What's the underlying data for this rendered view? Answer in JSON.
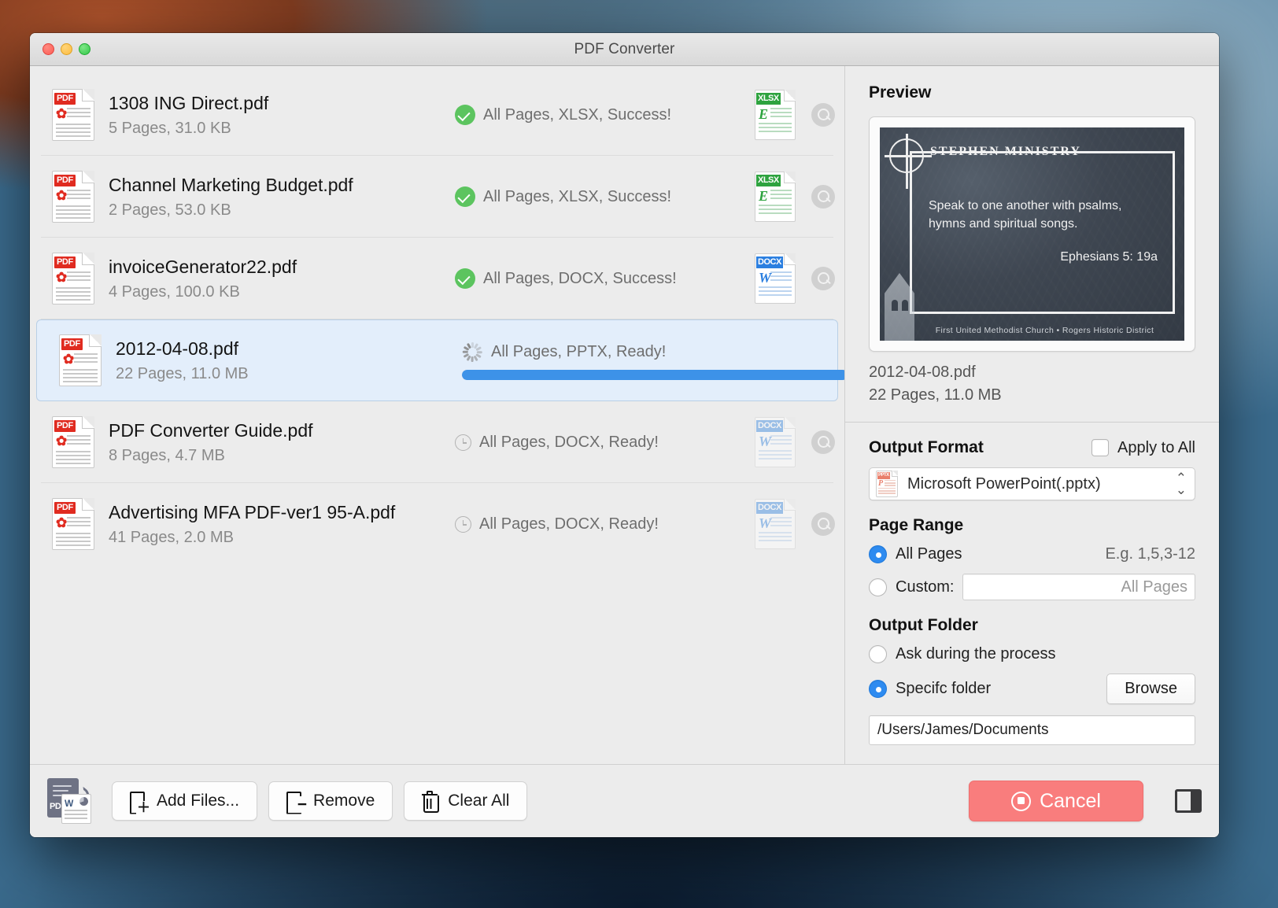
{
  "window": {
    "title": "PDF Converter",
    "traffic_lights": [
      "close-button",
      "minimize-button",
      "maximize-button"
    ]
  },
  "files": [
    {
      "name": "1308 ING Direct.pdf",
      "meta": "5 Pages, 31.0 KB",
      "status": "All Pages, XLSX, Success!",
      "state": "success",
      "format": "XLSX",
      "format_glyph": "E",
      "selected": false,
      "progress": null
    },
    {
      "name": "Channel Marketing Budget.pdf",
      "meta": "2 Pages, 53.0 KB",
      "status": "All Pages, XLSX, Success!",
      "state": "success",
      "format": "XLSX",
      "format_glyph": "E",
      "selected": false,
      "progress": null
    },
    {
      "name": "invoiceGenerator22.pdf",
      "meta": "4 Pages, 100.0 KB",
      "status": "All Pages, DOCX, Success!",
      "state": "success",
      "format": "DOCX",
      "format_glyph": "W",
      "selected": false,
      "progress": null
    },
    {
      "name": "2012-04-08.pdf",
      "meta": "22 Pages, 11.0 MB",
      "status": "All Pages, PPTX, Ready!",
      "state": "converting",
      "format": "PPTX",
      "format_glyph": "P",
      "selected": true,
      "progress": 89
    },
    {
      "name": "PDF Converter Guide.pdf",
      "meta": "8 Pages, 4.7 MB",
      "status": "All Pages, DOCX, Ready!",
      "state": "ready",
      "format": "DOCX",
      "format_glyph": "W",
      "selected": false,
      "progress": null
    },
    {
      "name": "Advertising MFA PDF-ver1 95-A.pdf",
      "meta": "41 Pages, 2.0 MB",
      "status": "All Pages, DOCX, Ready!",
      "state": "ready",
      "format": "DOCX",
      "format_glyph": "W",
      "selected": false,
      "progress": null
    }
  ],
  "preview": {
    "heading": "Preview",
    "slide": {
      "brand": "STEPHEN  MINISTRY",
      "quote": "Speak to one another with psalms, hymns and spiritual songs.",
      "reference": "Ephesians 5: 19a",
      "footer": "First United Methodist Church • Rogers Historic District"
    },
    "file_name": "2012-04-08.pdf",
    "file_meta": "22 Pages, 11.0 MB"
  },
  "output_format": {
    "heading": "Output Format",
    "apply_to_all_label": "Apply to All",
    "apply_to_all_checked": false,
    "selected": "Microsoft PowerPoint(.pptx)",
    "selected_format": "PPTX",
    "selected_glyph": "P",
    "chevron": "⌃⌄"
  },
  "page_range": {
    "heading": "Page Range",
    "all_pages_label": "All Pages",
    "all_pages_selected": true,
    "custom_label": "Custom:",
    "custom_selected": false,
    "example_hint": "E.g. 1,5,3-12",
    "custom_placeholder": "All Pages"
  },
  "output_folder": {
    "heading": "Output Folder",
    "ask_label": "Ask during the process",
    "ask_selected": false,
    "specific_label": "Specifc folder",
    "specific_selected": true,
    "browse_label": "Browse",
    "path": "/Users/James/Documents"
  },
  "footer": {
    "add_files_label": "Add Files...",
    "remove_label": "Remove",
    "clear_all_label": "Clear All",
    "cancel_label": "Cancel",
    "app_logo_text": "PDF"
  },
  "colors": {
    "accent_blue": "#2e8bf0",
    "success_green": "#5cc45f",
    "cancel_red": "#f97d7d",
    "progress_blue": "#3d92e8"
  }
}
